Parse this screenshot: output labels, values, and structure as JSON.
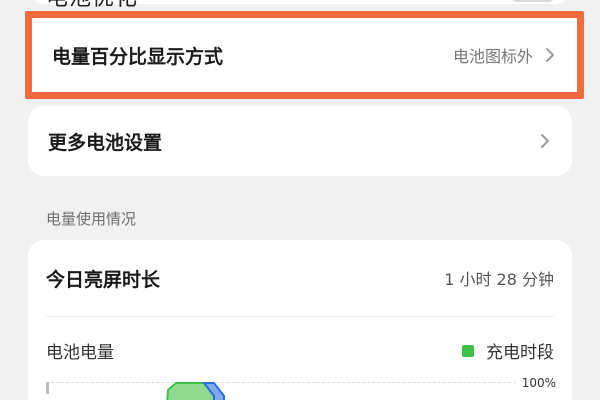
{
  "partial_top": {
    "title": "电池优化",
    "toggle": "off"
  },
  "display_mode": {
    "label": "电量百分比显示方式",
    "value": "电池图标外"
  },
  "more_settings": {
    "label": "更多电池设置"
  },
  "usage_section": {
    "label": "电量使用情况"
  },
  "screen_time": {
    "label": "今日亮屏时长",
    "value": "1 小时 28 分钟"
  },
  "battery_chart": {
    "label": "电池电量",
    "legend": "充电时段",
    "pct_label": "100%",
    "colors": {
      "charging": "#3cc24a",
      "usage": "#2b6fe0",
      "highlight": "#ef6a3d"
    }
  }
}
